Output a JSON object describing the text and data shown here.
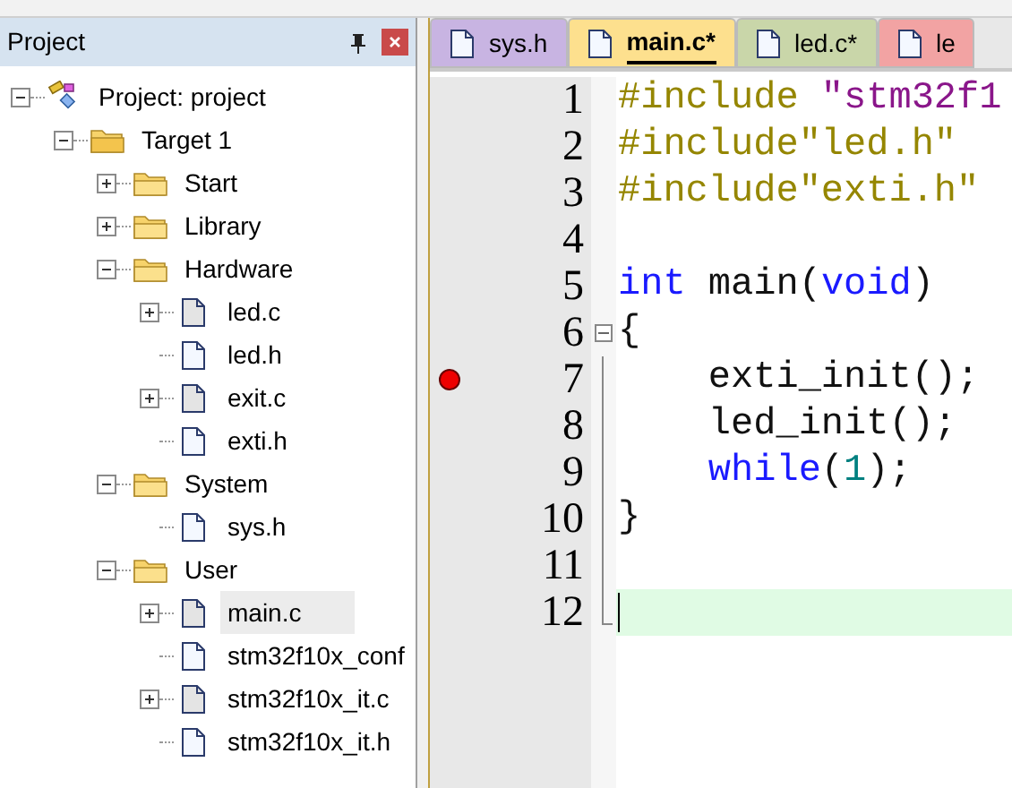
{
  "project_panel": {
    "title": "Project",
    "tree": [
      {
        "label": "Project: project",
        "kind": "project",
        "expanded": true,
        "selected": false,
        "children": [
          {
            "label": "Target 1",
            "kind": "target",
            "expanded": true,
            "selected": false,
            "children": [
              {
                "label": "Start",
                "kind": "folder",
                "expanded": false,
                "selected": false
              },
              {
                "label": "Library",
                "kind": "folder",
                "expanded": false,
                "selected": false
              },
              {
                "label": "Hardware",
                "kind": "folder",
                "expanded": true,
                "selected": false,
                "children": [
                  {
                    "label": "led.c",
                    "kind": "source",
                    "expanded": false,
                    "selected": false
                  },
                  {
                    "label": "led.h",
                    "kind": "header",
                    "selected": false
                  },
                  {
                    "label": "exit.c",
                    "kind": "source",
                    "expanded": false,
                    "selected": false
                  },
                  {
                    "label": "exti.h",
                    "kind": "header",
                    "selected": false
                  }
                ]
              },
              {
                "label": "System",
                "kind": "folder",
                "expanded": true,
                "selected": false,
                "children": [
                  {
                    "label": "sys.h",
                    "kind": "header",
                    "selected": false
                  }
                ]
              },
              {
                "label": "User",
                "kind": "folder",
                "expanded": true,
                "selected": false,
                "children": [
                  {
                    "label": "main.c",
                    "kind": "source",
                    "expanded": false,
                    "selected": true
                  },
                  {
                    "label": "stm32f10x_conf",
                    "kind": "header",
                    "selected": false
                  },
                  {
                    "label": "stm32f10x_it.c",
                    "kind": "source",
                    "expanded": false,
                    "selected": false
                  },
                  {
                    "label": "stm32f10x_it.h",
                    "kind": "header",
                    "selected": false
                  }
                ]
              }
            ]
          }
        ]
      }
    ]
  },
  "editor": {
    "tabs": [
      {
        "label": "sys.h",
        "selected": false,
        "color": "#c8b4e2"
      },
      {
        "label": "main.c*",
        "selected": true,
        "color": "#fde08e"
      },
      {
        "label": "led.c*",
        "selected": false,
        "color": "#c9d6a9"
      },
      {
        "label": "le",
        "selected": false,
        "color": "#f2a3a3"
      }
    ],
    "lines": [
      {
        "number": "1",
        "breakpoint": false,
        "current": false,
        "tokens": [
          {
            "text": "#include ",
            "kind": "preprocessor"
          },
          {
            "text": "\"stm32f1",
            "kind": "string"
          }
        ]
      },
      {
        "number": "2",
        "breakpoint": false,
        "current": false,
        "tokens": [
          {
            "text": "#include\"led.h\"",
            "kind": "preprocessor"
          }
        ]
      },
      {
        "number": "3",
        "breakpoint": false,
        "current": false,
        "tokens": [
          {
            "text": "#include\"exti.h\"",
            "kind": "preprocessor"
          }
        ]
      },
      {
        "number": "4",
        "breakpoint": false,
        "current": false
      },
      {
        "number": "5",
        "breakpoint": false,
        "current": false,
        "tokens": [
          {
            "text": "int",
            "kind": "keyword"
          },
          {
            "text": " main(",
            "kind": "plain"
          },
          {
            "text": "void",
            "kind": "keyword"
          },
          {
            "text": ")",
            "kind": "plain"
          }
        ]
      },
      {
        "number": "6",
        "breakpoint": false,
        "current": false,
        "fold_start": true,
        "tokens": [
          {
            "text": "{",
            "kind": "plain"
          }
        ]
      },
      {
        "number": "7",
        "breakpoint": true,
        "current": false,
        "tokens": [
          {
            "text": "    exti_init();",
            "kind": "plain"
          }
        ]
      },
      {
        "number": "8",
        "breakpoint": false,
        "current": false,
        "tokens": [
          {
            "text": "    led_init();",
            "kind": "plain"
          }
        ]
      },
      {
        "number": "9",
        "breakpoint": false,
        "current": false,
        "tokens": [
          {
            "text": "    while",
            "kind": "keyword"
          },
          {
            "text": "(",
            "kind": "plain"
          },
          {
            "text": "1",
            "kind": "number"
          },
          {
            "text": ");",
            "kind": "plain"
          }
        ]
      },
      {
        "number": "10",
        "breakpoint": false,
        "current": false,
        "tokens": [
          {
            "text": "}",
            "kind": "plain"
          }
        ]
      },
      {
        "number": "11",
        "breakpoint": false,
        "current": false
      },
      {
        "number": "12",
        "breakpoint": false,
        "current": true,
        "fold_end": true
      }
    ]
  }
}
